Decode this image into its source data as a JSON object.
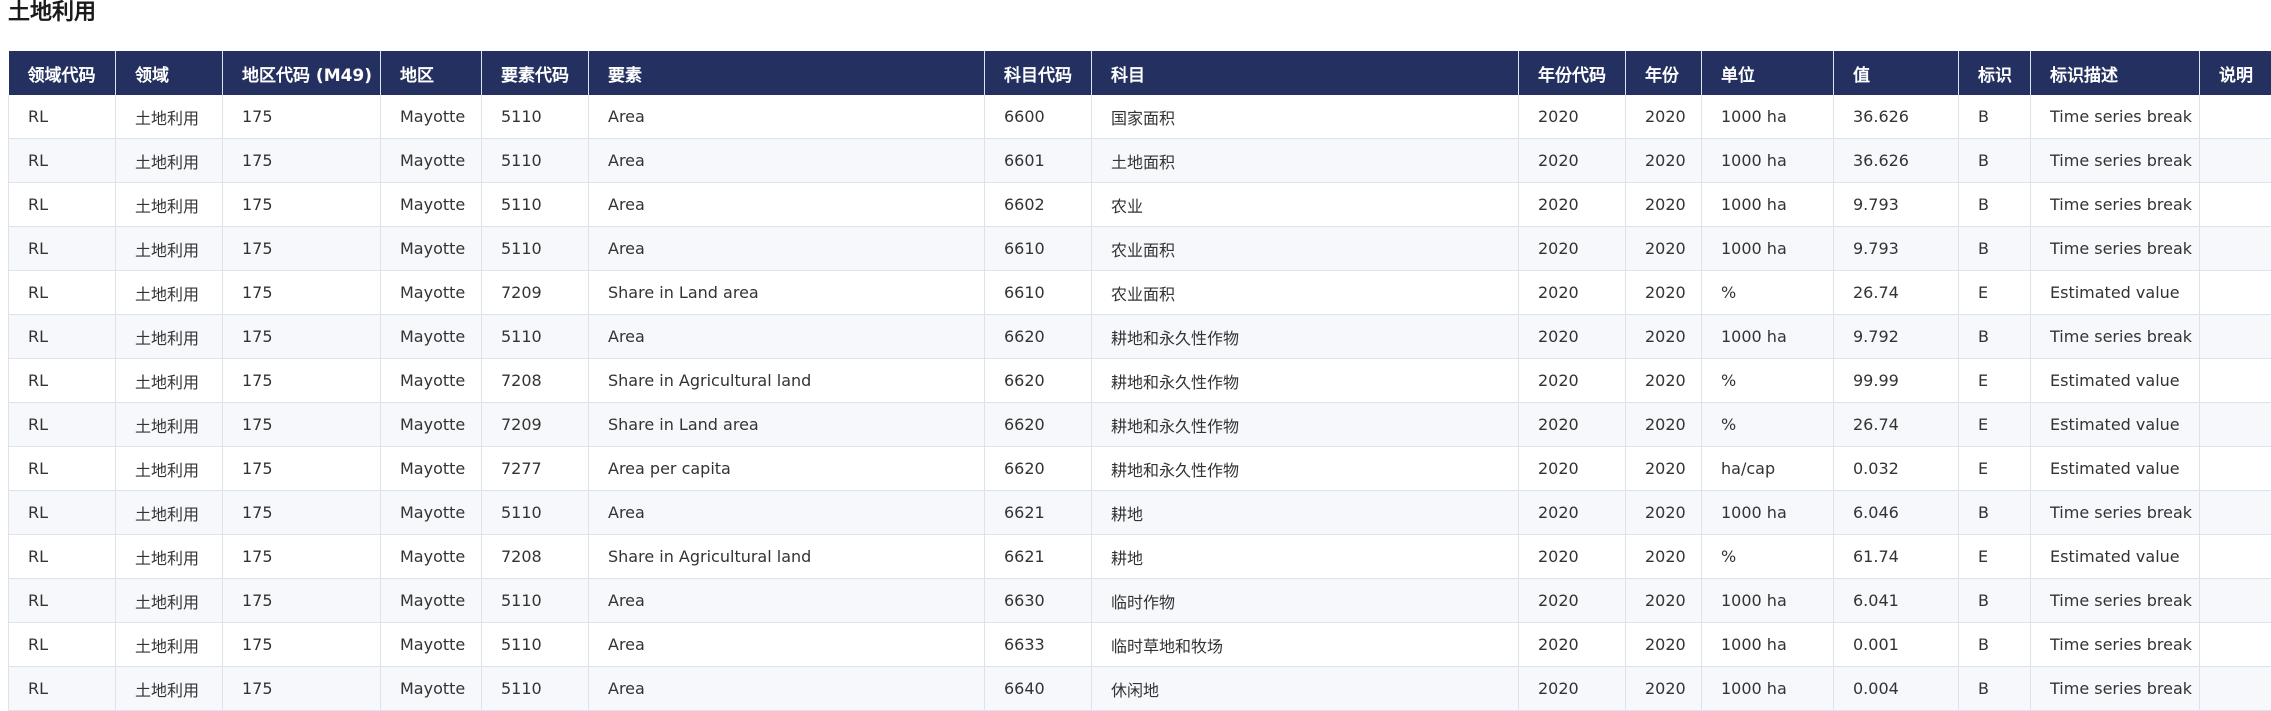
{
  "page": {
    "title": "土地利用"
  },
  "table": {
    "columns": [
      "领域代码",
      "领域",
      "地区代码 (M49)",
      "地区",
      "要素代码",
      "要素",
      "科目代码",
      "科目",
      "年份代码",
      "年份",
      "单位",
      "值",
      "标识",
      "标识描述",
      "说明"
    ],
    "rows": [
      [
        "RL",
        "土地利用",
        "175",
        "Mayotte",
        "5110",
        "Area",
        "6600",
        "国家面积",
        "2020",
        "2020",
        "1000 ha",
        "36.626",
        "B",
        "Time series break",
        ""
      ],
      [
        "RL",
        "土地利用",
        "175",
        "Mayotte",
        "5110",
        "Area",
        "6601",
        "土地面积",
        "2020",
        "2020",
        "1000 ha",
        "36.626",
        "B",
        "Time series break",
        ""
      ],
      [
        "RL",
        "土地利用",
        "175",
        "Mayotte",
        "5110",
        "Area",
        "6602",
        "农业",
        "2020",
        "2020",
        "1000 ha",
        "9.793",
        "B",
        "Time series break",
        ""
      ],
      [
        "RL",
        "土地利用",
        "175",
        "Mayotte",
        "5110",
        "Area",
        "6610",
        "农业面积",
        "2020",
        "2020",
        "1000 ha",
        "9.793",
        "B",
        "Time series break",
        ""
      ],
      [
        "RL",
        "土地利用",
        "175",
        "Mayotte",
        "7209",
        "Share in Land area",
        "6610",
        "农业面积",
        "2020",
        "2020",
        "%",
        "26.74",
        "E",
        "Estimated value",
        ""
      ],
      [
        "RL",
        "土地利用",
        "175",
        "Mayotte",
        "5110",
        "Area",
        "6620",
        "耕地和永久性作物",
        "2020",
        "2020",
        "1000 ha",
        "9.792",
        "B",
        "Time series break",
        ""
      ],
      [
        "RL",
        "土地利用",
        "175",
        "Mayotte",
        "7208",
        "Share in Agricultural land",
        "6620",
        "耕地和永久性作物",
        "2020",
        "2020",
        "%",
        "99.99",
        "E",
        "Estimated value",
        ""
      ],
      [
        "RL",
        "土地利用",
        "175",
        "Mayotte",
        "7209",
        "Share in Land area",
        "6620",
        "耕地和永久性作物",
        "2020",
        "2020",
        "%",
        "26.74",
        "E",
        "Estimated value",
        ""
      ],
      [
        "RL",
        "土地利用",
        "175",
        "Mayotte",
        "7277",
        "Area per capita",
        "6620",
        "耕地和永久性作物",
        "2020",
        "2020",
        "ha/cap",
        "0.032",
        "E",
        "Estimated value",
        ""
      ],
      [
        "RL",
        "土地利用",
        "175",
        "Mayotte",
        "5110",
        "Area",
        "6621",
        "耕地",
        "2020",
        "2020",
        "1000 ha",
        "6.046",
        "B",
        "Time series break",
        ""
      ],
      [
        "RL",
        "土地利用",
        "175",
        "Mayotte",
        "7208",
        "Share in Agricultural land",
        "6621",
        "耕地",
        "2020",
        "2020",
        "%",
        "61.74",
        "E",
        "Estimated value",
        ""
      ],
      [
        "RL",
        "土地利用",
        "175",
        "Mayotte",
        "5110",
        "Area",
        "6630",
        "临时作物",
        "2020",
        "2020",
        "1000 ha",
        "6.041",
        "B",
        "Time series break",
        ""
      ],
      [
        "RL",
        "土地利用",
        "175",
        "Mayotte",
        "5110",
        "Area",
        "6633",
        "临时草地和牧场",
        "2020",
        "2020",
        "1000 ha",
        "0.001",
        "B",
        "Time series break",
        ""
      ],
      [
        "RL",
        "土地利用",
        "175",
        "Mayotte",
        "5110",
        "Area",
        "6640",
        "休闲地",
        "2020",
        "2020",
        "1000 ha",
        "0.004",
        "B",
        "Time series break",
        ""
      ]
    ]
  }
}
